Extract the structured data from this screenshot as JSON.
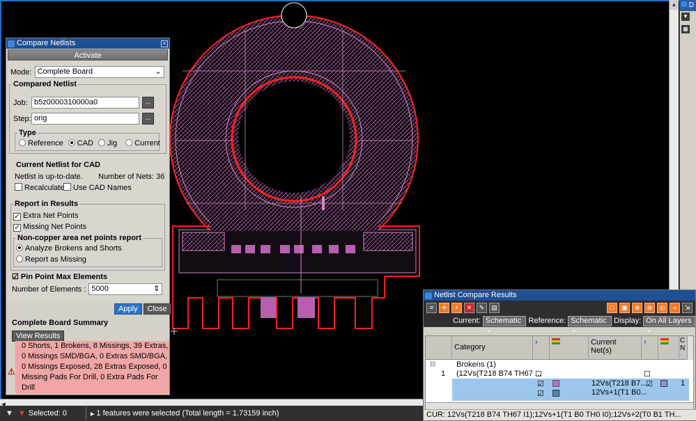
{
  "compare_dialog": {
    "title": "Compare Netlists",
    "activate_label": "Activate",
    "mode_label": "Mode:",
    "mode_value": "Complete Board",
    "compared_netlist_title": "Compared Netlist",
    "job_label": "Job:",
    "job_value": "b5z0000310000a0",
    "step_label": "Step:",
    "step_value": "orig",
    "browse_label": "...",
    "type_title": "Type",
    "type_options": [
      "Reference",
      "CAD",
      "Jig",
      "Current"
    ],
    "type_selected": "CAD",
    "current_netlist_title": "Current Netlist for CAD",
    "netlist_status": "Netlist is up-to-date.",
    "number_of_nets": "Number of Nets: 36",
    "recalculate_label": "Recalculate",
    "use_cad_names_label": "Use CAD Names",
    "report_title": "Report in Results",
    "extra_net_points_label": "Extra Net Points",
    "missing_net_points_label": "Missing Net Points",
    "noncopper_title": "Non-copper area net points report",
    "analyze_label": "Analyze Brokens and Shorts",
    "report_missing_label": "Report as Missing",
    "pin_point_title": "Pin Point Max Elements",
    "num_elements_label": "Number of Elements :",
    "num_elements_value": "5000",
    "apply_label": "Apply",
    "close_label": "Close",
    "summary_title": "Complete Board Summary",
    "view_results_label": "View Results",
    "summary_lines": [
      "0 Shorts,  1 Brokens,  8 Missings,  39 Extras,",
      "0 Missings SMD/BGA,  0 Extras SMD/BGA,",
      "0 Missings Exposed,  28 Extras Exposed,  0",
      "Missing Pads For Drill,  0 Extra Pads For Drill"
    ]
  },
  "results_panel": {
    "title": "Netlist Compare Results",
    "current_label": "Current:",
    "current_value": "Schematic",
    "reference_label": "Reference:",
    "reference_value": "Schematic",
    "display_label": "Display:",
    "display_value": "On All Layers",
    "col_category": "Category",
    "col_current_nets": "Current Net(s)",
    "col_c": "C N",
    "group_label": "Brokens (1)",
    "row1_index": "1",
    "row1_text": "(12Vs(T218 B74 TH67 ...",
    "row2_net": "12Vs(T218 B7...",
    "row3_net": "12Vs+1(T1 B0...",
    "row2_extra": "1",
    "status": "CUR: 12Vs(T218 B74 TH67 I1);12Vs+1(T1 B0 TH0 I0);12Vs+2(T0 B1 TH..."
  },
  "statusbar": {
    "selected": "Selected: 0",
    "message": "1 features were selected (Total length = 1.73159 inch)"
  },
  "right_panel": {
    "header": "D"
  },
  "colors": {
    "outline": "#ff2020",
    "copper": "#b85fb0",
    "title_blue": "#1f4f95",
    "warning_fill": "#f0a6a6"
  }
}
